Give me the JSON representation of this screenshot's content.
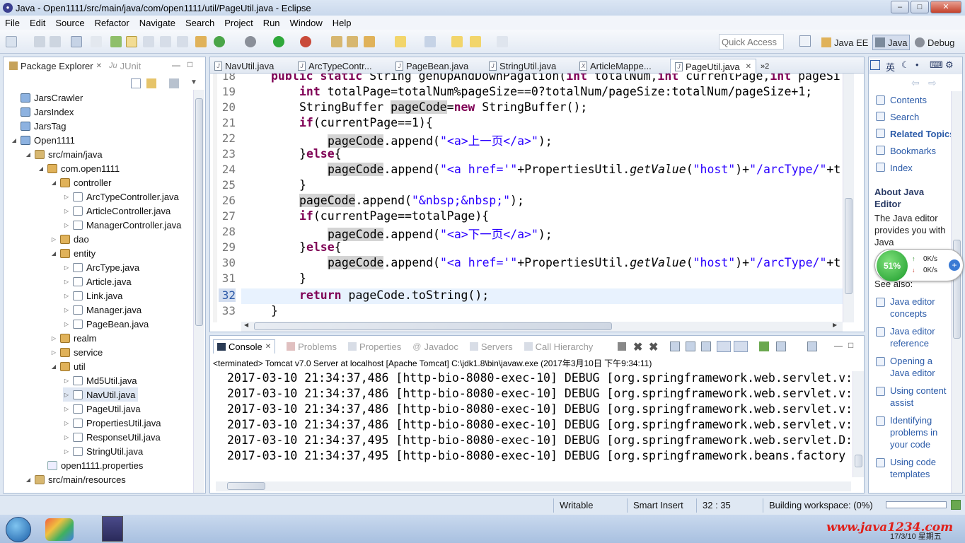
{
  "window": {
    "title": "Java - Open1111/src/main/java/com/open1111/util/PageUtil.java - Eclipse"
  },
  "menu": [
    "File",
    "Edit",
    "Source",
    "Refactor",
    "Navigate",
    "Search",
    "Project",
    "Run",
    "Window",
    "Help"
  ],
  "toolbar": {
    "quick_access_placeholder": "Quick Access",
    "perspectives": [
      "Java EE",
      "Java",
      "Debug"
    ]
  },
  "package_explorer": {
    "tabs": [
      "Package Explorer",
      "JUnit"
    ],
    "tree": [
      {
        "label": "JarsCrawler",
        "icon": "project-icon"
      },
      {
        "label": "JarsIndex",
        "icon": "project-icon"
      },
      {
        "label": "JarsTag",
        "icon": "project-icon"
      },
      {
        "label": "Open1111",
        "icon": "project-icon"
      },
      {
        "label": "src/main/java",
        "icon": "source-folder-icon"
      },
      {
        "label": "com.open1111",
        "icon": "package-icon"
      },
      {
        "label": "controller",
        "icon": "package-icon"
      },
      {
        "label": "ArcTypeController.java",
        "icon": "java-file-icon"
      },
      {
        "label": "ArticleController.java",
        "icon": "java-file-icon"
      },
      {
        "label": "ManagerController.java",
        "icon": "java-file-icon"
      },
      {
        "label": "dao",
        "icon": "package-icon"
      },
      {
        "label": "entity",
        "icon": "package-icon"
      },
      {
        "label": "ArcType.java",
        "icon": "java-file-icon"
      },
      {
        "label": "Article.java",
        "icon": "java-file-icon"
      },
      {
        "label": "Link.java",
        "icon": "java-file-icon"
      },
      {
        "label": "Manager.java",
        "icon": "java-file-icon"
      },
      {
        "label": "PageBean.java",
        "icon": "java-file-icon"
      },
      {
        "label": "realm",
        "icon": "package-icon"
      },
      {
        "label": "service",
        "icon": "package-icon"
      },
      {
        "label": "util",
        "icon": "package-icon"
      },
      {
        "label": "Md5Util.java",
        "icon": "java-file-icon"
      },
      {
        "label": "NavUtil.java",
        "icon": "java-file-icon"
      },
      {
        "label": "PageUtil.java",
        "icon": "java-file-icon"
      },
      {
        "label": "PropertiesUtil.java",
        "icon": "java-file-icon"
      },
      {
        "label": "ResponseUtil.java",
        "icon": "java-file-icon"
      },
      {
        "label": "StringUtil.java",
        "icon": "java-file-icon"
      },
      {
        "label": "open1111.properties",
        "icon": "properties-file-icon"
      },
      {
        "label": "src/main/resources",
        "icon": "source-folder-icon"
      }
    ]
  },
  "editor": {
    "tabs": [
      "NavUtil.java",
      "ArcTypeContr...",
      "PageBean.java",
      "StringUtil.java",
      "ArticleMappe...",
      "PageUtil.java"
    ],
    "overflow_count": "»2",
    "line_numbers": [
      "18",
      "19",
      "20",
      "21",
      "22",
      "23",
      "24",
      "25",
      "26",
      "27",
      "28",
      "29",
      "30",
      "31",
      "32",
      "33"
    ],
    "line18": {
      "kw": "public static",
      "rest": " String genUpAndDownPagation(",
      "kw2": "int",
      "p1": " totalNum,",
      "kw3": "int",
      "p2": " currentPage,",
      "kw4": "int",
      "p3": " pageSi"
    },
    "line19": {
      "kw": "int",
      "rest": " totalPage=totalNum%pageSize==0?totalNum/pageSize:totalNum/pageSize+1;"
    },
    "line20": {
      "a": "StringBuffer ",
      "var": "pageCode",
      "b": "=",
      "kw": "new",
      "c": " StringBuffer();"
    },
    "line21": {
      "kw": "if",
      "rest": "(currentPage==1){"
    },
    "line22": {
      "var": "pageCode",
      "a": ".append(",
      "str": "\"<a>上一页</a>\"",
      "b": ");"
    },
    "line23": {
      "a": "}",
      "kw": "else",
      "b": "{"
    },
    "line24": {
      "var": "pageCode",
      "a": ".append(",
      "str": "\"<a href='\"",
      "b": "+PropertiesUtil.",
      "m": "getValue",
      "c": "(",
      "str2": "\"host\"",
      "d": ")+",
      "str3": "\"/arcType/\"",
      "e": "+t"
    },
    "line25": {
      "a": "}"
    },
    "line26": {
      "var": "pageCode",
      "a": ".append(",
      "str": "\"&nbsp;&nbsp;\"",
      "b": ");"
    },
    "line27": {
      "kw": "if",
      "rest": "(currentPage==totalPage){"
    },
    "line28": {
      "var": "pageCode",
      "a": ".append(",
      "str": "\"<a>下一页</a>\"",
      "b": ");"
    },
    "line29": {
      "a": "}",
      "kw": "else",
      "b": "{"
    },
    "line30": {
      "var": "pageCode",
      "a": ".append(",
      "str": "\"<a href='\"",
      "b": "+PropertiesUtil.",
      "m": "getValue",
      "c": "(",
      "str2": "\"host\"",
      "d": ")+",
      "str3": "\"/arcType/\"",
      "e": "+t"
    },
    "line31": {
      "a": "}"
    },
    "line32": {
      "kw": "return",
      "rest": " pageCode.toString();"
    },
    "line33": {
      "a": "}"
    }
  },
  "console": {
    "tabs": [
      "Console",
      "Problems",
      "Properties",
      "Javadoc",
      "Servers",
      "Call Hierarchy"
    ],
    "terminated": "<terminated> Tomcat v7.0 Server at localhost [Apache Tomcat] C:\\jdk1.8\\bin\\javaw.exe (2017年3月10日 下午9:34:11)",
    "lines": [
      "2017-03-10 21:34:37,486 [http-bio-8080-exec-10] DEBUG [org.springframework.web.servlet.v:",
      "2017-03-10 21:34:37,486 [http-bio-8080-exec-10] DEBUG [org.springframework.web.servlet.v:",
      "2017-03-10 21:34:37,486 [http-bio-8080-exec-10] DEBUG [org.springframework.web.servlet.v:",
      "2017-03-10 21:34:37,486 [http-bio-8080-exec-10] DEBUG [org.springframework.web.servlet.v:",
      "2017-03-10 21:34:37,495 [http-bio-8080-exec-10] DEBUG [org.springframework.web.servlet.D:",
      "2017-03-10 21:34:37,495 [http-bio-8080-exec-10] DEBUG [org.springframework.beans.factory"
    ]
  },
  "help": {
    "ime": "英",
    "links": [
      "Contents",
      "Search",
      "Related Topics",
      "Bookmarks",
      "Index"
    ],
    "about_title": "About Java Editor",
    "about_text": "The Java editor provides you with Java",
    "see_also": "See also:",
    "see_also_links": [
      "Java editor concepts",
      "Java editor reference",
      "Opening a Java editor",
      "Using content assist",
      "Identifying problems in your code",
      "Using code templates"
    ]
  },
  "net_widget": {
    "percent": "51%",
    "up": "0K/s",
    "down": "0K/s"
  },
  "status_bar": {
    "mode": "Writable",
    "insert": "Smart Insert",
    "position": "32 : 35",
    "task": "Building workspace: (0%)"
  },
  "taskbar": {
    "watermark": "www.java1234.com",
    "clock": "17/3/10 星期五"
  }
}
